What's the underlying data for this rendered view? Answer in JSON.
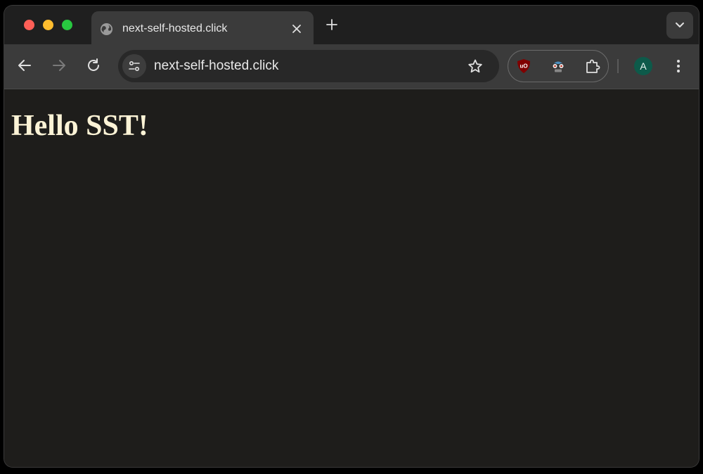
{
  "window": {
    "traffic_lights": {
      "close_color": "#fe5f57",
      "minimize_color": "#febc2e",
      "maximize_color": "#28c840"
    }
  },
  "tabs": [
    {
      "title": "next-self-hosted.click",
      "favicon": "globe-icon",
      "active": true
    }
  ],
  "tab_strip": {
    "new_tab_icon": "plus-icon",
    "tab_search_icon": "chevron-down-icon"
  },
  "toolbar": {
    "back_icon": "arrow-left-icon",
    "forward_icon": "arrow-right-icon",
    "reload_icon": "reload-icon",
    "site_info_icon": "tune-icon",
    "url": "next-self-hosted.click",
    "bookmark_icon": "star-icon",
    "extensions": [
      {
        "name": "ublock-origin",
        "icon": "ublock-shield-icon"
      },
      {
        "name": "glasses-extension",
        "icon": "glasses-icon"
      },
      {
        "name": "extensions-menu",
        "icon": "puzzle-icon"
      }
    ],
    "profile_initial": "A",
    "profile_color": "#0d5a4a",
    "menu_icon": "kebab-icon"
  },
  "page": {
    "heading": "Hello SST!",
    "background": "#1e1d1b",
    "heading_color": "#fcf3d6"
  }
}
